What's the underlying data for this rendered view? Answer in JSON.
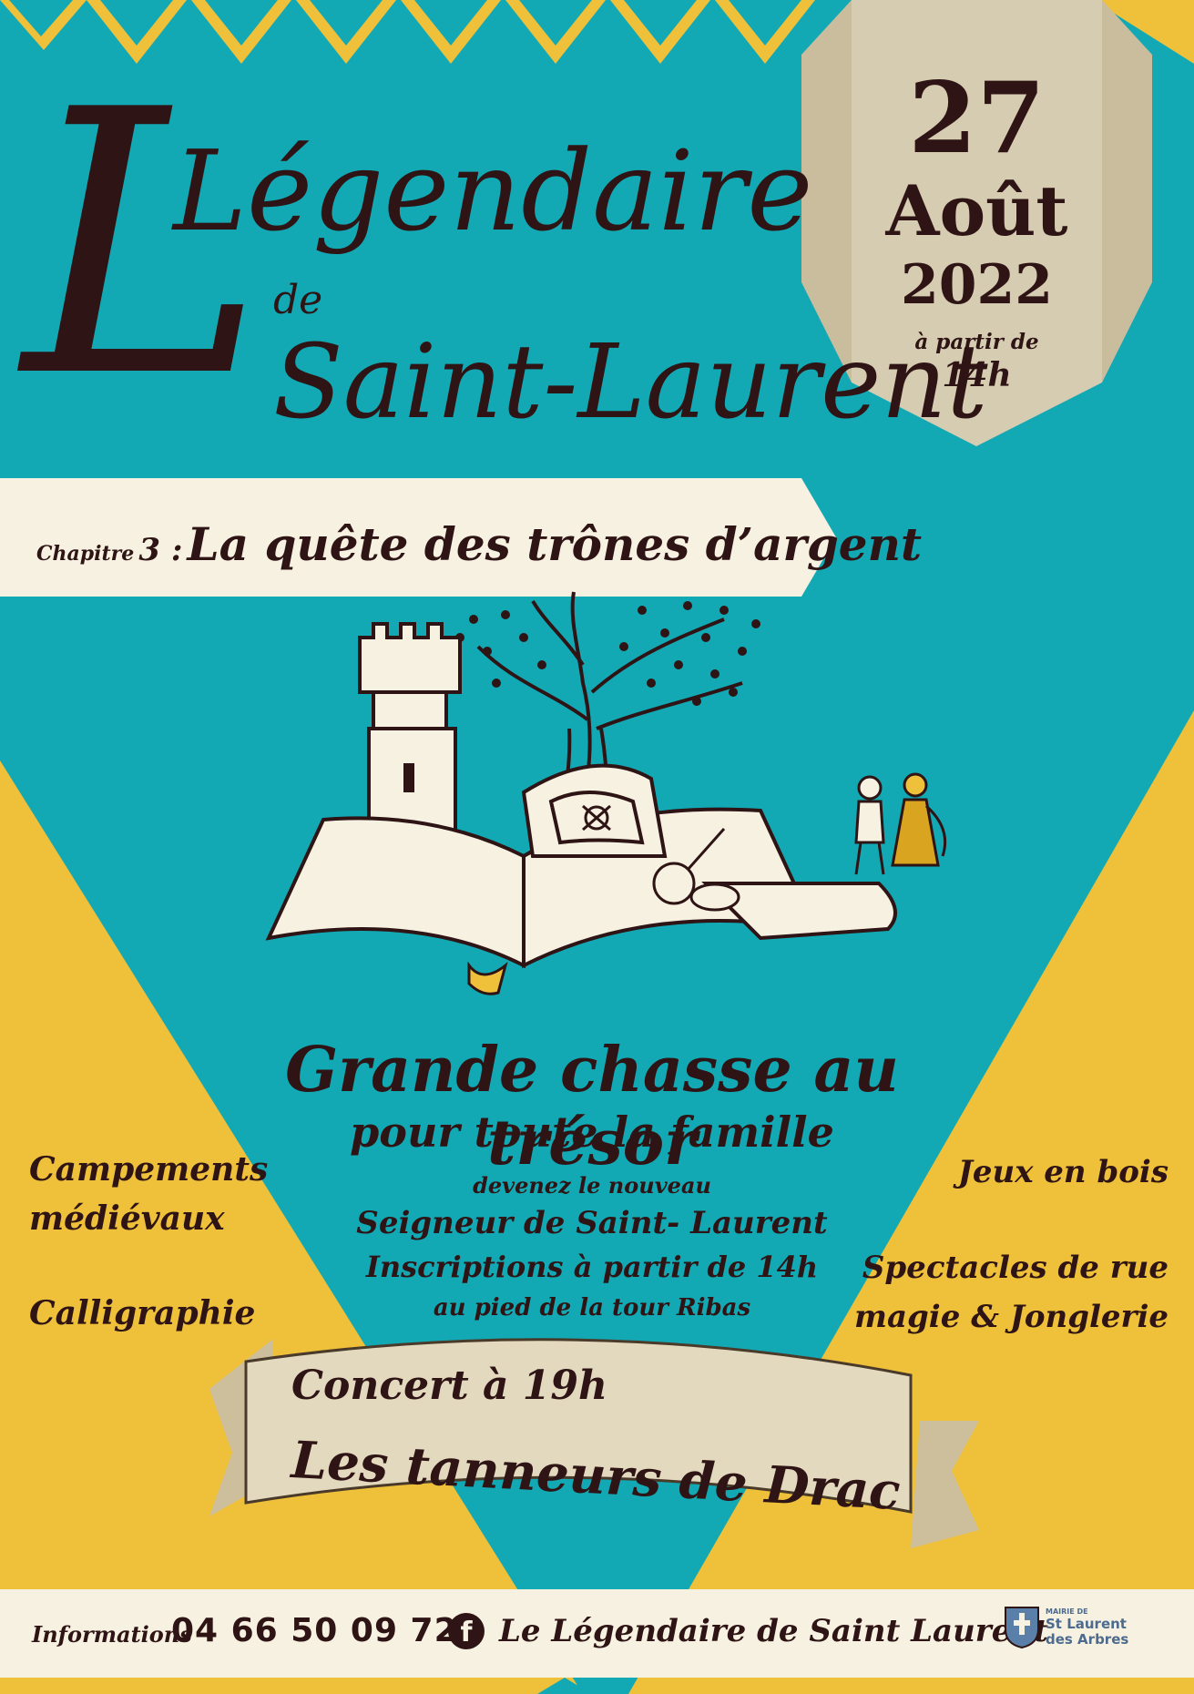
{
  "title": {
    "line1": "Légendaire",
    "line2": "de",
    "line3": "Saint-Laurent"
  },
  "date_banner": {
    "day": "27",
    "month": "Août",
    "year": "2022",
    "from_label": "à partir de",
    "time": "14h"
  },
  "chapter": {
    "label": "Chapitre",
    "number": "3 :",
    "name": "La quête des trônes d’argent"
  },
  "main_event": {
    "headline": "Grande chasse au trésor",
    "subheadline": "pour toute la famille",
    "lines": [
      "devenez le nouveau",
      "Seigneur de Saint- Laurent",
      "Inscriptions à partir de 14h",
      "au pied de la tour Ribas"
    ]
  },
  "left_activities": [
    "Campements",
    "médiévaux",
    "Calligraphie"
  ],
  "right_activities": [
    "Jeux en bois",
    "Spectacles de rue",
    "magie & Jonglerie"
  ],
  "concert": {
    "time_line": "Concert à 19h",
    "band": "Les tanneurs de Drac"
  },
  "footer": {
    "info_label": "Informations",
    "phone": "04 66 50 09 72",
    "facebook_icon": "facebook-icon",
    "facebook_page": "Le Légendaire de Saint Laurent",
    "mairie_small": "MAIRIE DE",
    "mairie_name1": "St Laurent",
    "mairie_name2": "des Arbres"
  },
  "colors": {
    "teal": "#13a9b4",
    "mustard": "#efc03a",
    "cream": "#f6f1e1",
    "parchment": "#dcd2b8",
    "ink": "#2e1414"
  }
}
